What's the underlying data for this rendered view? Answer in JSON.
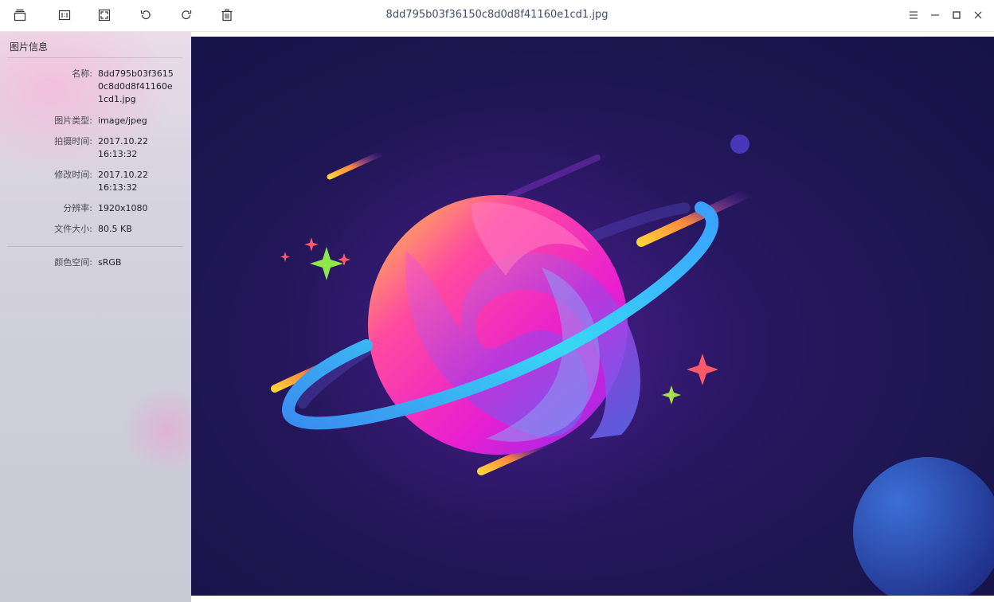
{
  "window": {
    "title": "8dd795b03f36150c8d0d8f41160e1cd1.jpg"
  },
  "toolbar": {
    "buttons": [
      {
        "icon": "album-icon"
      },
      {
        "icon": "actual-size-icon"
      },
      {
        "icon": "fit-window-icon"
      },
      {
        "icon": "rotate-left-icon"
      },
      {
        "icon": "rotate-right-icon"
      },
      {
        "icon": "delete-icon"
      }
    ]
  },
  "window_controls": {
    "menu_icon": "menu-icon",
    "minimize_icon": "minimize-icon",
    "maximize_icon": "maximize-icon",
    "close_icon": "close-icon"
  },
  "info_panel": {
    "title": "图片信息",
    "fields": [
      {
        "label": "名称:",
        "value": "8dd795b03f36150c8d0d8f41160e1cd1.jpg"
      },
      {
        "label": "图片类型:",
        "value": "image/jpeg"
      },
      {
        "label": "拍摄时间:",
        "value": "2017.10.22 16:13:32"
      },
      {
        "label": "修改时间:",
        "value": "2017.10.22 16:13:32"
      },
      {
        "label": "分辨率:",
        "value": "1920x1080"
      },
      {
        "label": "文件大小:",
        "value": "80.5 KB"
      },
      {
        "label": "颜色空间:",
        "value": "sRGB"
      }
    ]
  },
  "colors": {
    "accent": "#0081ff",
    "viewer_background": "#1d1650"
  }
}
